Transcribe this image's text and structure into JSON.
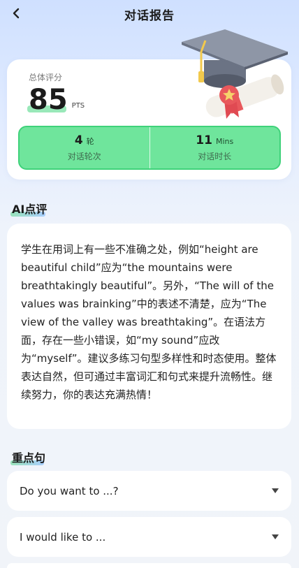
{
  "header": {
    "title": "对话报告",
    "back_icon": "chevron-left-icon"
  },
  "score": {
    "label": "总体评分",
    "value": "85",
    "unit": "PTS",
    "stats": [
      {
        "num": "4",
        "unit": "轮",
        "label": "对话轮次"
      },
      {
        "num": "11",
        "unit": "Mins",
        "label": "对话时长"
      }
    ]
  },
  "review": {
    "heading": "AI点评",
    "text": "学生在用词上有一些不准确之处，例如“height are beautiful child”应为“the mountains were breathtakingly beautiful”。另外，“The will of the values was brainking”中的表述不清楚，应为“The view of the valley was breathtaking”。在语法方面，存在一些小错误，如“my sound”应改为“myself”。建议多练习句型多样性和时态使用。整体表达自然，但可通过丰富词汇和句式来提升流畅性。继续努力，你的表达充满热情！"
  },
  "key_sentences": {
    "heading": "重点句",
    "items": [
      {
        "text": "Do you want to ...?"
      },
      {
        "text": "I would like to ..."
      }
    ]
  },
  "colors": {
    "accent_green": "#6fe59c",
    "background_top": "#cfe0ff"
  }
}
